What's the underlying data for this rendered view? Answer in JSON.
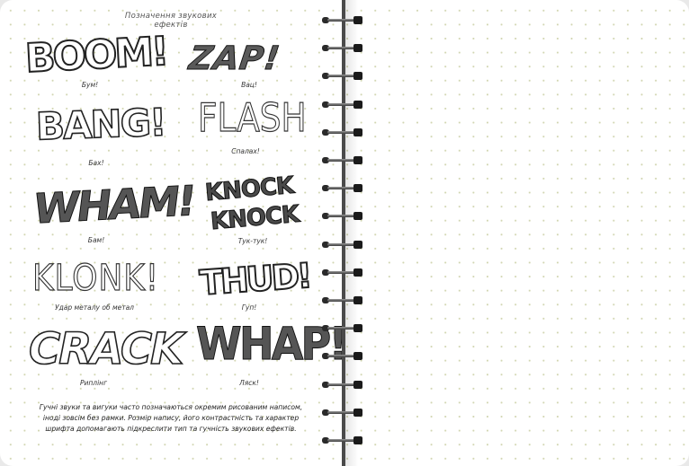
{
  "page": {
    "title": "Позначення звукових ефектів",
    "body_text": "Гучні звуки та вигуки часто позначаються окремим рисованим написом, іноді зовсім без рамки. Розмір напису, його контрастність та характер шрифта допомагають підкреслити тип та гучність звукових ефектів."
  },
  "effects": [
    {
      "id": "boom",
      "word": "BOOM!",
      "caption": "Бум!"
    },
    {
      "id": "zap",
      "word": "ZAP!",
      "caption": "Вац!"
    },
    {
      "id": "bang",
      "word": "BANG!",
      "caption": "Бах!"
    },
    {
      "id": "flash",
      "word": "FLASH",
      "caption": "Спалах!"
    },
    {
      "id": "wham",
      "word": "WHAM!",
      "caption": "Бам!"
    },
    {
      "id": "knock",
      "word": "KNOCK",
      "word2": "KNOCK",
      "caption": "Тук-тук!"
    },
    {
      "id": "klonk",
      "word": "KLONK!",
      "caption": "Удар металу об метал"
    },
    {
      "id": "thud",
      "word": "THUD!",
      "caption": "Гуп!"
    },
    {
      "id": "crack",
      "word": "CRACK",
      "caption": "Риплінг"
    },
    {
      "id": "whap",
      "word": "WHAP!",
      "caption": "Ляск!"
    }
  ],
  "colors": {
    "paper": "#ffffff",
    "dot_grid": "#d2d6b2",
    "spine": "#4a4a4a",
    "ink": "#222222"
  }
}
